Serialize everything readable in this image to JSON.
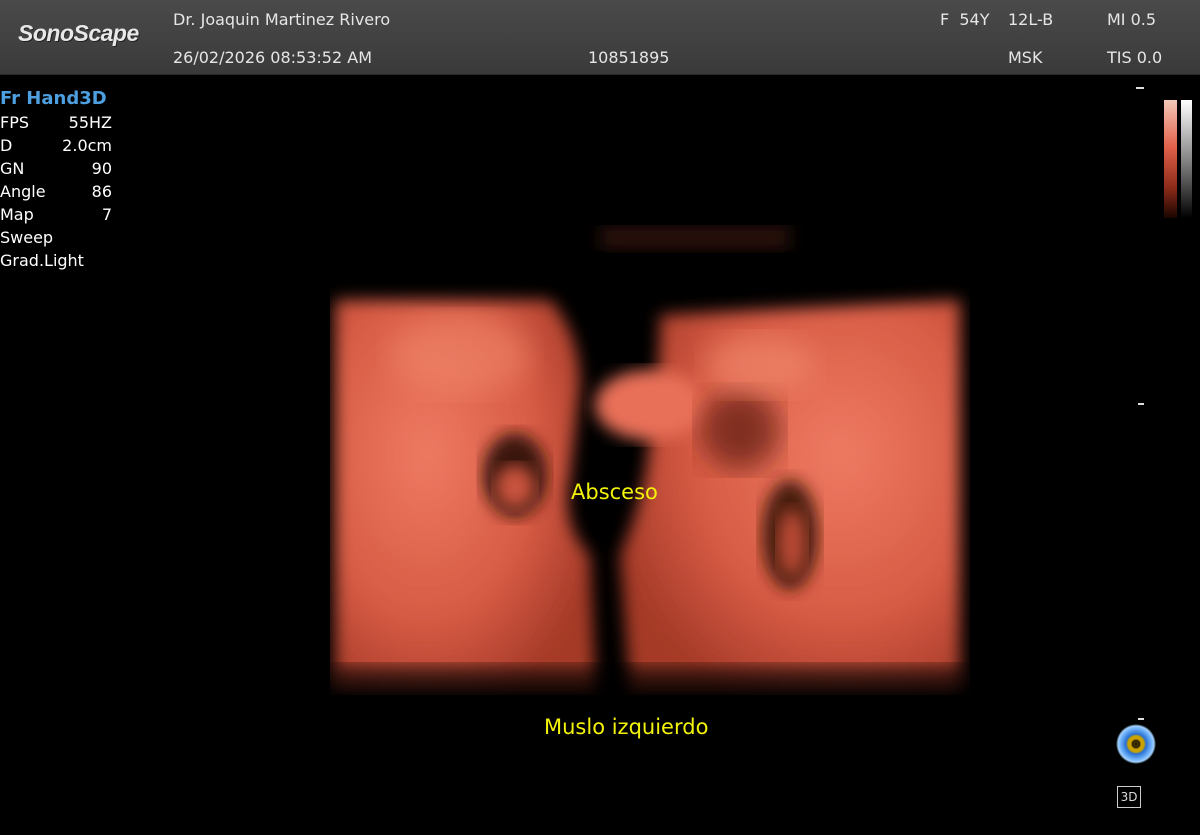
{
  "header": {
    "brand": "SonoScape",
    "doctor": "Dr. Joaquin Martinez Rivero",
    "datetime": "26/02/2026 08:53:52 AM",
    "patient_id": "10851895",
    "sex_age": "F  54Y",
    "probe": "12L-B",
    "preset": "MSK",
    "mi": "MI 0.5",
    "tis": "TIS 0.0"
  },
  "params": {
    "mode": "Fr Hand3D",
    "rows": [
      {
        "label": "FPS",
        "value": "55HZ"
      },
      {
        "label": "D",
        "value": "2.0cm"
      },
      {
        "label": "GN",
        "value": "90"
      },
      {
        "label": "Angle",
        "value": "86"
      },
      {
        "label": "Map",
        "value": "7"
      },
      {
        "label": "Sweep",
        "value": ""
      },
      {
        "label": "Grad.Light",
        "value": ""
      }
    ]
  },
  "annotations": {
    "absceso": "Absceso",
    "muslo": "Muslo izquierdo"
  },
  "controls": {
    "btn_3d": "3D"
  },
  "colors": {
    "label_yellow": "#f2f20a",
    "mode_blue": "#4d9fe0",
    "render_tissue": "#e0604a"
  }
}
